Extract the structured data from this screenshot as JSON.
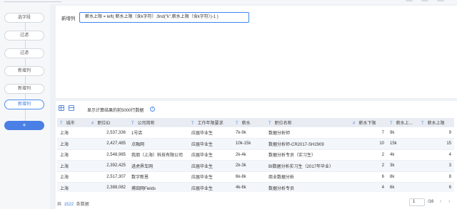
{
  "flow": {
    "steps": [
      "选字段",
      "过滤",
      "过滤",
      "新增列",
      "新增列",
      "新增列"
    ],
    "active_index": 5,
    "add_label": "+"
  },
  "formula": {
    "label": "新增列",
    "expression": "薪水上限 = left( 薪水上限（含k字符）,find(\"k\",薪水上限（含k字符）)-1 )"
  },
  "preview": {
    "toolbar_text": "显示计算结果的前5000行数据",
    "info_glyph": "i",
    "columns": [
      {
        "type": "T",
        "name": "城市"
      },
      {
        "type": "#",
        "name": "职位ID"
      },
      {
        "type": "T",
        "name": "公司简称"
      },
      {
        "type": "T",
        "name": "工作年限要求"
      },
      {
        "type": "T",
        "name": "薪水"
      },
      {
        "type": "T",
        "name": "职位名称"
      },
      {
        "type": "#",
        "name": "薪水下限"
      },
      {
        "type": "T",
        "name": "薪水上..."
      },
      {
        "type": "T",
        "name": "薪水上限"
      }
    ],
    "rows": [
      [
        "上海",
        "2,537,336",
        "1号店",
        "应届毕业生",
        "7k-9k",
        "数据分析师",
        "7",
        "9k",
        "9"
      ],
      [
        "上海",
        "2,427,485",
        "点融网",
        "应届毕业生",
        "10k-15k",
        "数据分析师-CR2017-SH2909",
        "10",
        "15k",
        "15"
      ],
      [
        "上海",
        "2,548,985",
        "我朋（上海）科技有限公司",
        "应届毕业生",
        "2k-4k",
        "数据分析专员（实习生）",
        "2",
        "4k",
        "4"
      ],
      [
        "上海",
        "2,392,425",
        "进虎界车网",
        "应届毕业生",
        "2k-3k",
        "BI数据分析实习生（2017年毕业）",
        "2",
        "3k",
        "3"
      ],
      [
        "上海",
        "2,517,307",
        "数字新恩",
        "应届毕业生",
        "6k-8k",
        "商业数据分析",
        "6",
        "8k",
        "8"
      ],
      [
        "上海",
        "2,388,082",
        "甫田网Fields",
        "应届毕业生",
        "4k-6k",
        "数据分析专员",
        "4",
        "6k",
        "6"
      ]
    ],
    "footer": {
      "total_prefix": "共",
      "total_count": "1522",
      "total_suffix": "条数据",
      "page_input": "1",
      "page_total": "/16",
      "prev": "‹",
      "next": "›"
    }
  }
}
